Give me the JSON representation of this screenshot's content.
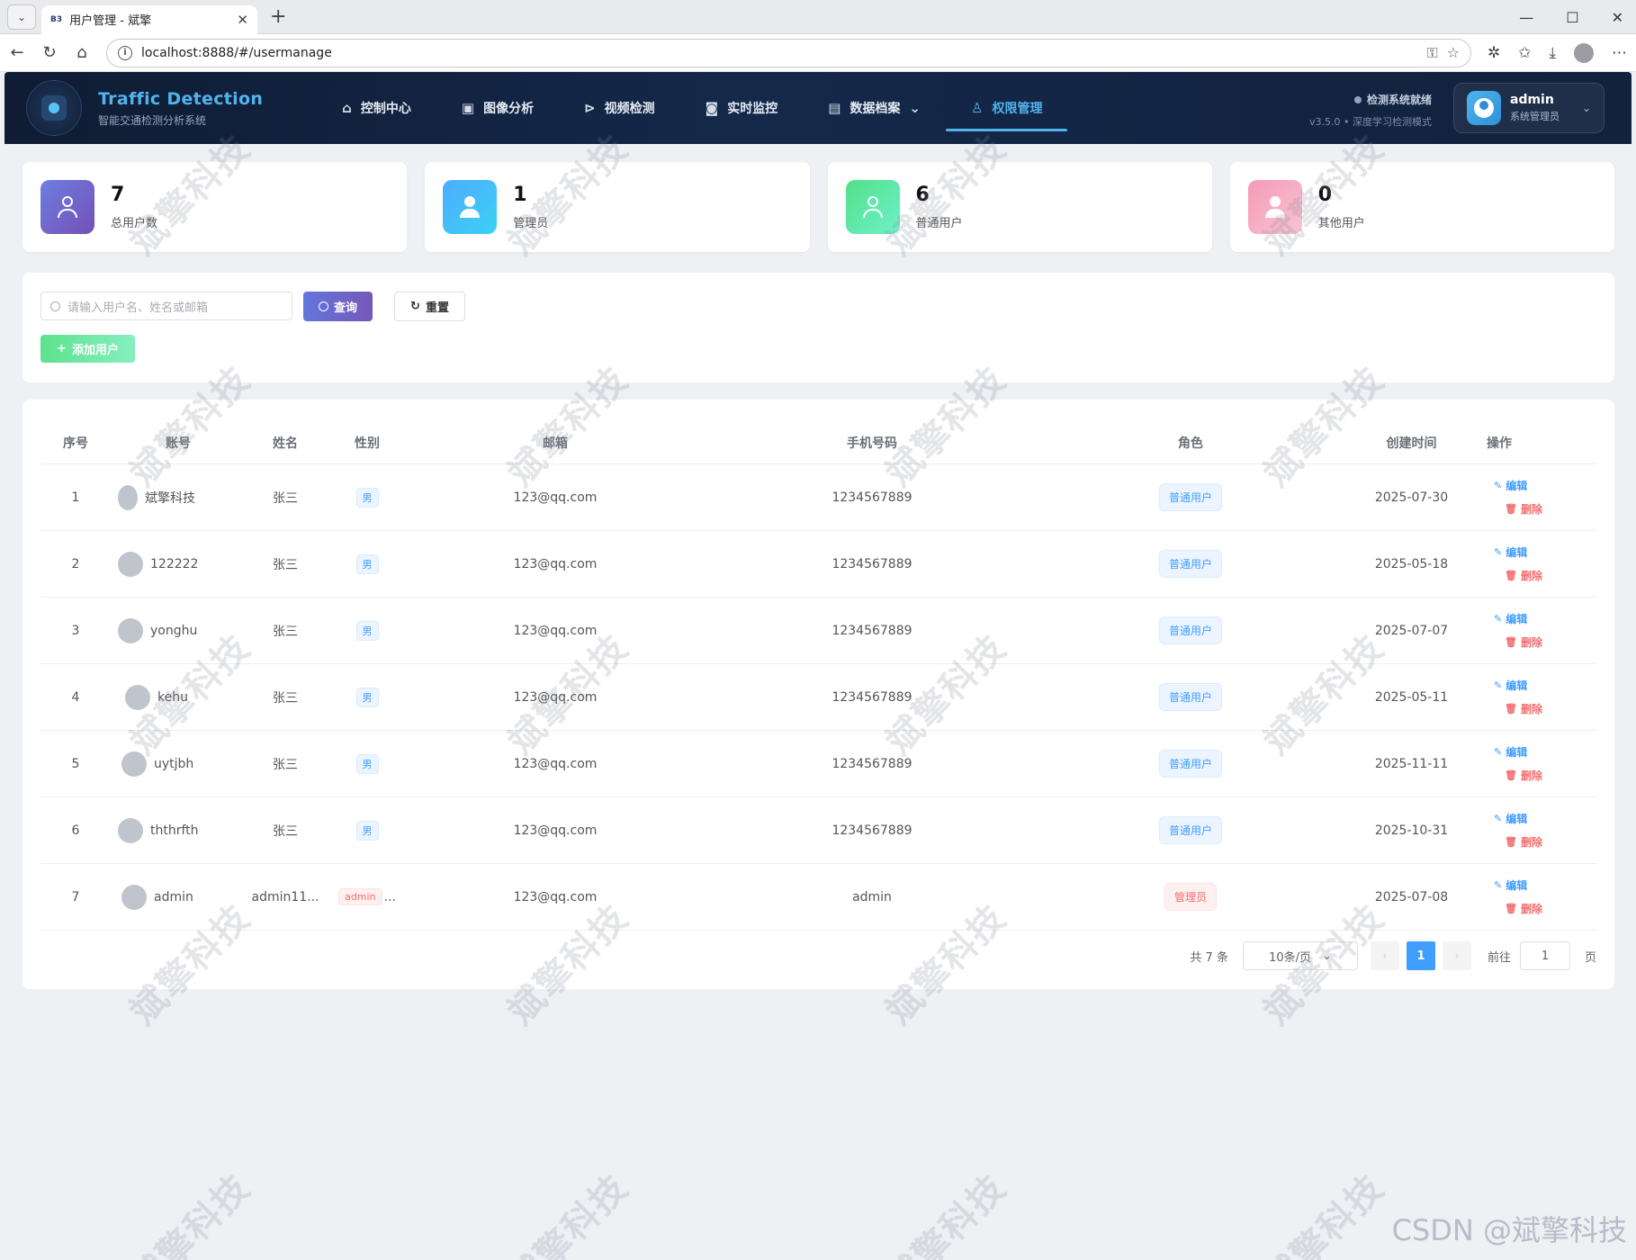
{
  "browser": {
    "tab_title": "用户管理 - 斌擎",
    "tab_favicon": "B3",
    "url": "localhost:8888/#/usermanage"
  },
  "header": {
    "brand_title": "Traffic Detection",
    "brand_subtitle": "智能交通检测分析系统",
    "nav": [
      {
        "label": "控制中心",
        "icon": "home-icon"
      },
      {
        "label": "图像分析",
        "icon": "image-icon"
      },
      {
        "label": "视频检测",
        "icon": "play-icon"
      },
      {
        "label": "实时监控",
        "icon": "camera-icon"
      },
      {
        "label": "数据档案",
        "icon": "document-icon"
      },
      {
        "label": "权限管理",
        "icon": "user-icon"
      }
    ],
    "status_text": "检测系统就绪",
    "version_text": "v3.5.0 • 深度学习检测模式",
    "user_name": "admin",
    "user_role": "系统管理员",
    "accent_color": "#4fb4ee"
  },
  "stats": [
    {
      "value": "7",
      "label": "总用户数"
    },
    {
      "value": "1",
      "label": "管理员"
    },
    {
      "value": "6",
      "label": "普通用户"
    },
    {
      "value": "0",
      "label": "其他用户"
    }
  ],
  "search": {
    "placeholder": "请输入用户名、姓名或邮箱",
    "query_label": "查询",
    "reset_label": "重置",
    "add_label": "添加用户"
  },
  "table": {
    "headers": [
      "序号",
      "账号",
      "姓名",
      "性别",
      "邮箱",
      "手机号码",
      "角色",
      "创建时间",
      "操作"
    ],
    "edit_label": "编辑",
    "delete_label": "删除",
    "rows": [
      {
        "idx": "1",
        "account": "斌擎科技",
        "name": "张三",
        "gender": "男",
        "email": "123@qq.com",
        "phone": "1234567889",
        "role": "普通用户",
        "created": "2025-07-30"
      },
      {
        "idx": "2",
        "account": "122222",
        "name": "张三",
        "gender": "男",
        "email": "123@qq.com",
        "phone": "1234567889",
        "role": "普通用户",
        "created": "2025-05-18"
      },
      {
        "idx": "3",
        "account": "yonghu",
        "name": "张三",
        "gender": "男",
        "email": "123@qq.com",
        "phone": "1234567889",
        "role": "普通用户",
        "created": "2025-07-07"
      },
      {
        "idx": "4",
        "account": "kehu",
        "name": "张三",
        "gender": "男",
        "email": "123@qq.com",
        "phone": "1234567889",
        "role": "普通用户",
        "created": "2025-05-11"
      },
      {
        "idx": "5",
        "account": "uytjbh",
        "name": "张三",
        "gender": "男",
        "email": "123@qq.com",
        "phone": "1234567889",
        "role": "普通用户",
        "created": "2025-11-11"
      },
      {
        "idx": "6",
        "account": "ththrfth",
        "name": "张三",
        "gender": "男",
        "email": "123@qq.com",
        "phone": "1234567889",
        "role": "普通用户",
        "created": "2025-10-31"
      },
      {
        "idx": "7",
        "account": "admin",
        "name": "admin11...",
        "gender": "admin",
        "gender_extra": "...",
        "email": "123@qq.com",
        "phone": "admin",
        "role": "管理员",
        "created": "2025-07-08"
      }
    ]
  },
  "pagination": {
    "total_text": "共 7 条",
    "page_size": "10条/页",
    "current_page": "1",
    "goto_label": "前往",
    "goto_value": "1",
    "page_suffix": "页"
  },
  "watermark": {
    "text": "斌擎科技",
    "csdn": "CSDN @斌擎科技"
  }
}
